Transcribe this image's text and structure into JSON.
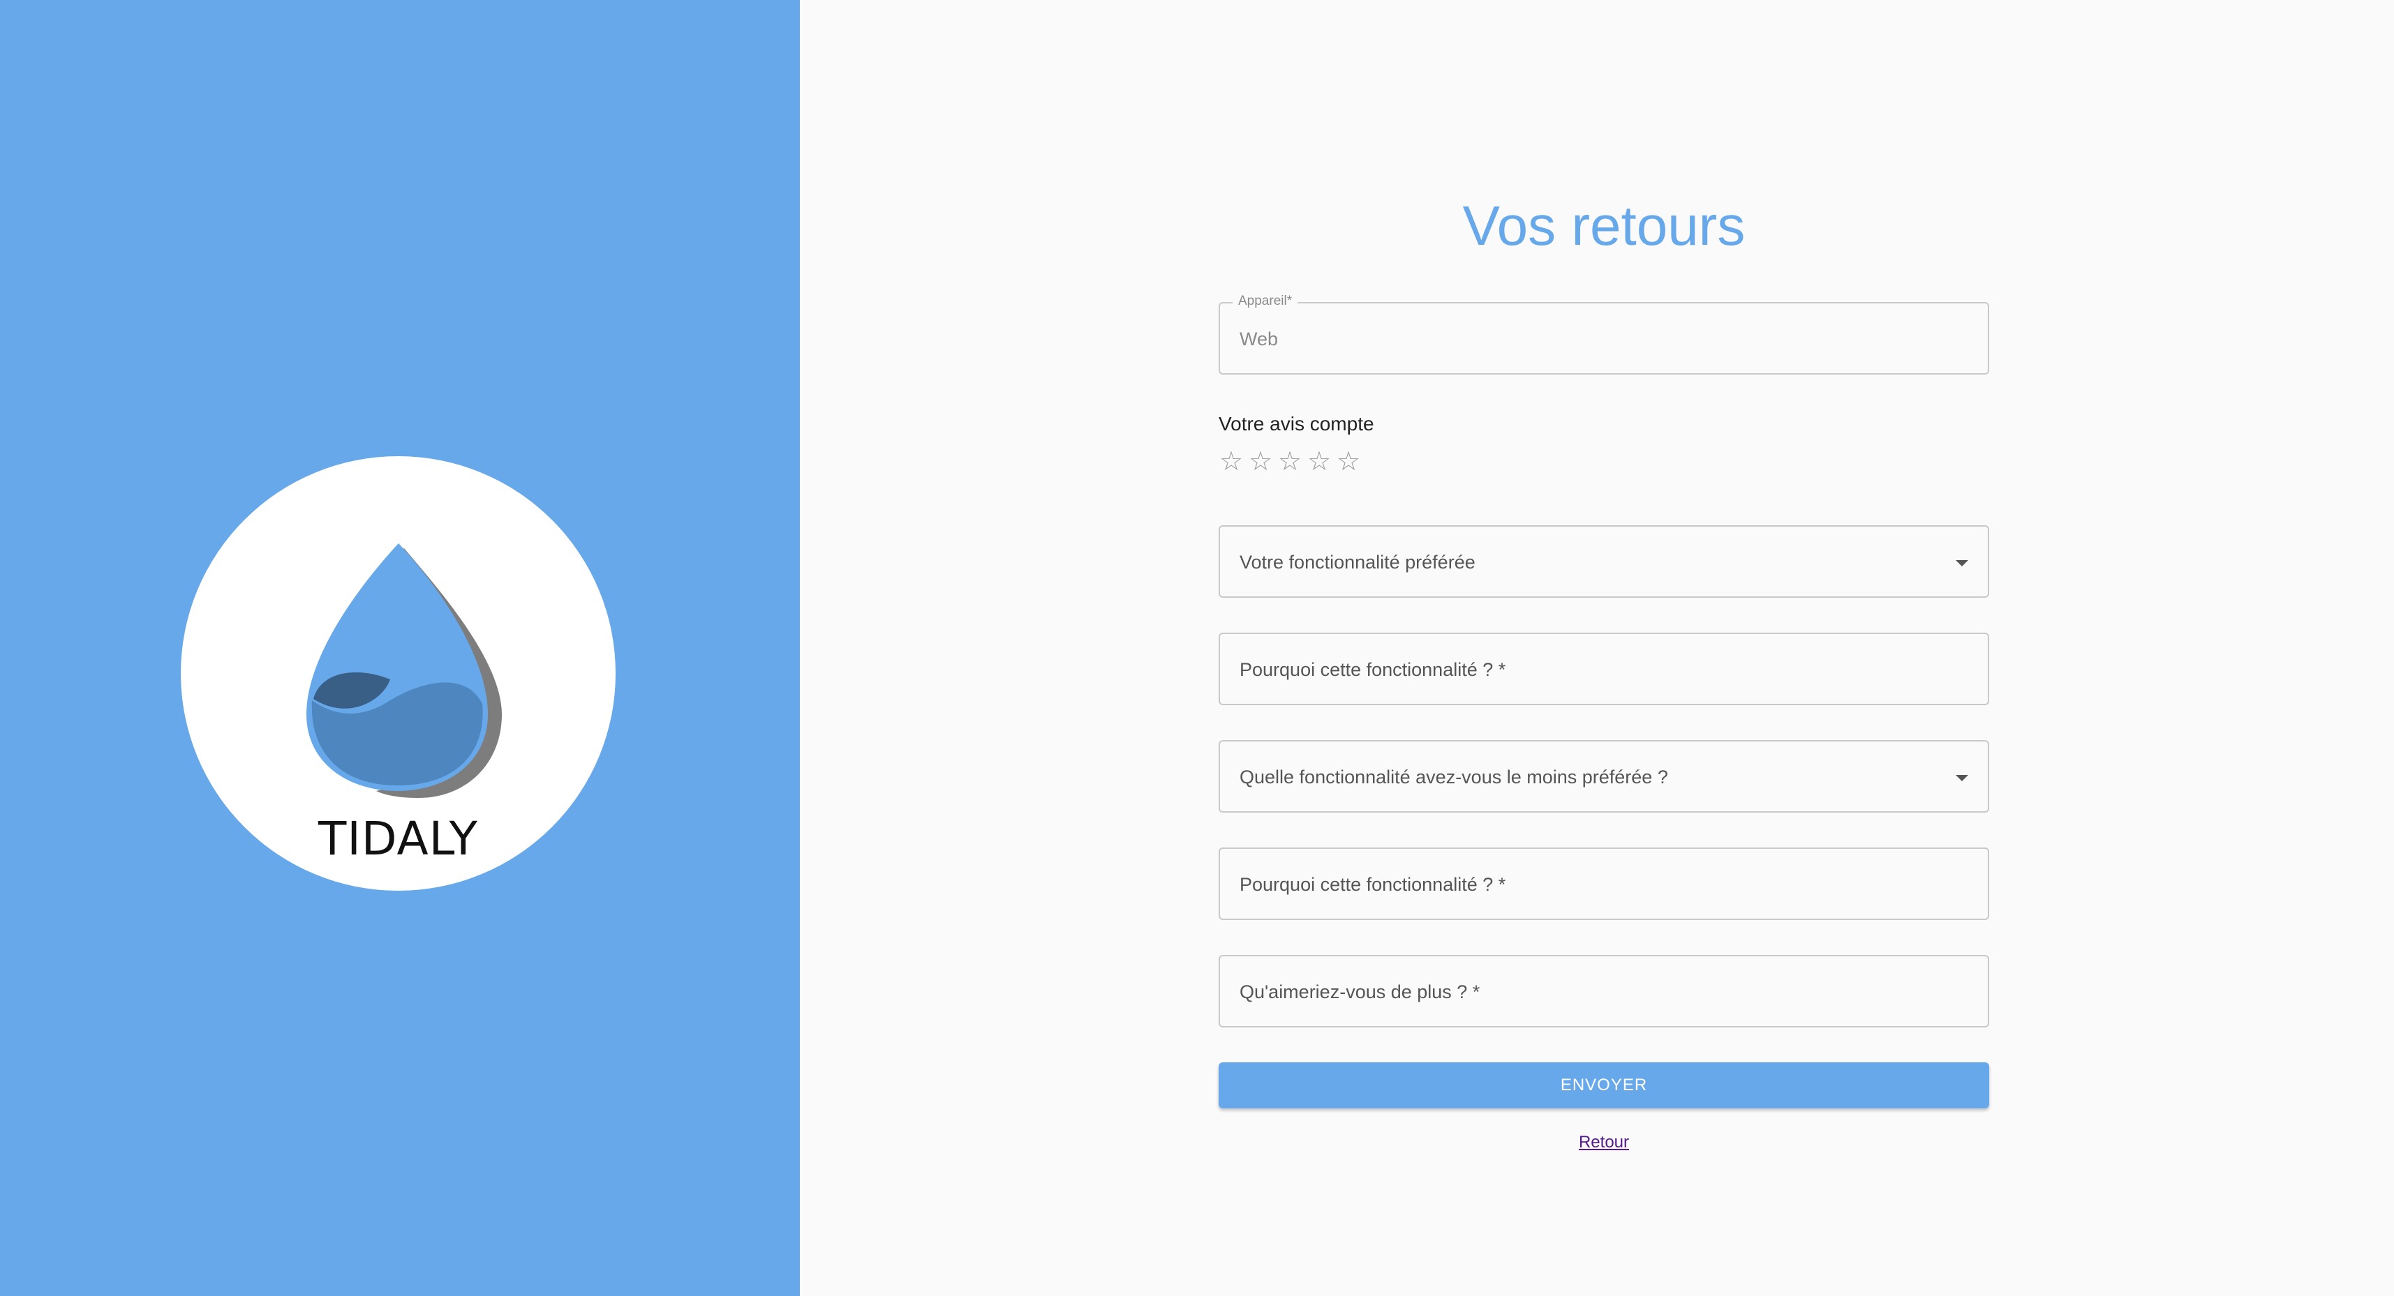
{
  "brand": {
    "name": "TIDALY"
  },
  "colors": {
    "accent": "#66a8e9",
    "background": "#fafafa",
    "link": "#551a8b"
  },
  "form": {
    "title": "Vos retours",
    "device_field": {
      "legend": "Appareil*",
      "value": "Web"
    },
    "rating": {
      "label": "Votre avis compte",
      "max": 5,
      "value": 0,
      "star_icon": "star-outline-icon"
    },
    "favorite_feature": {
      "label": "Votre fonctionnalité préférée"
    },
    "favorite_reason": {
      "label": "Pourquoi cette fonctionnalité ? *"
    },
    "least_favorite_feature": {
      "label": "Quelle fonctionnalité avez-vous le moins préférée ?"
    },
    "least_favorite_reason": {
      "label": "Pourquoi cette fonctionnalité ? *"
    },
    "wish": {
      "label": "Qu'aimeriez-vous de plus ? *"
    },
    "submit_label": "ENVOYER",
    "back_label": "Retour"
  }
}
